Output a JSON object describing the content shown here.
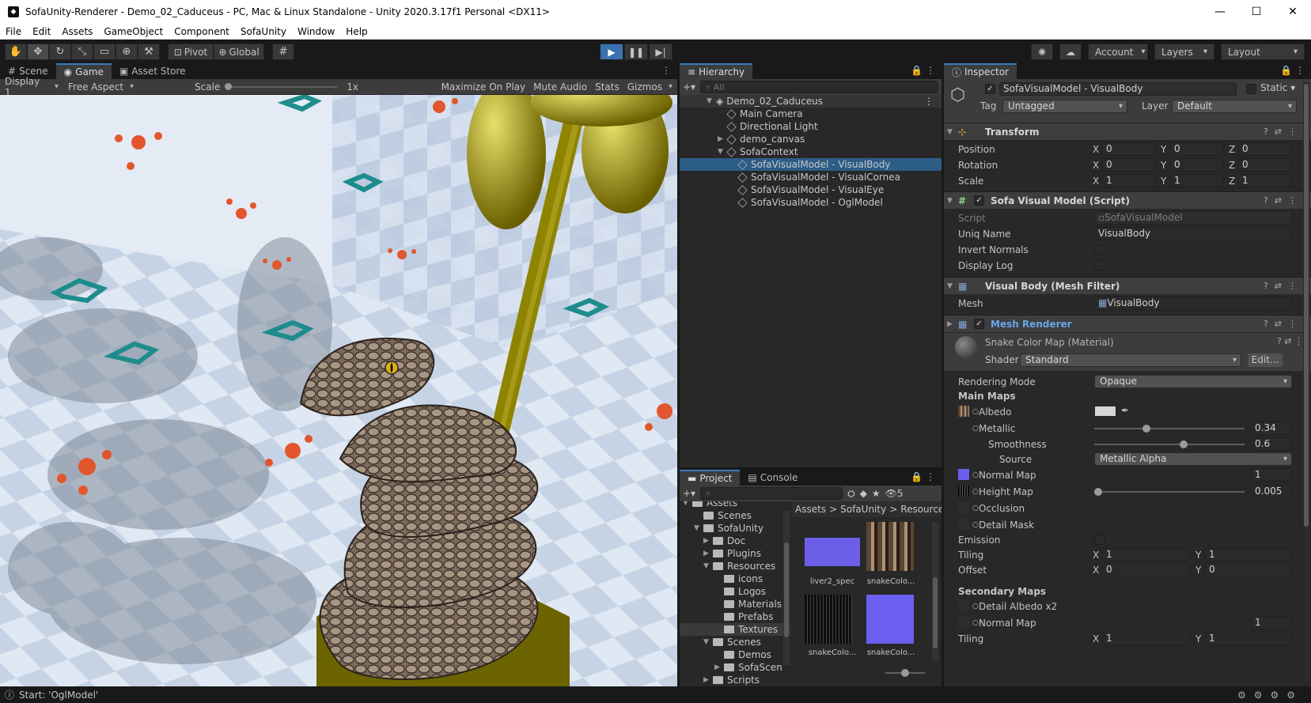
{
  "window": {
    "title": "SofaUnity-Renderer - Demo_02_Caduceus - PC, Mac & Linux Standalone - Unity 2020.3.17f1 Personal <DX11>",
    "minimize": "—",
    "maximize": "☐",
    "close": "✕"
  },
  "menu": [
    "File",
    "Edit",
    "Assets",
    "GameObject",
    "Component",
    "SofaUnity",
    "Window",
    "Help"
  ],
  "toolbar": {
    "pivot": "Pivot",
    "global": "Global",
    "account": "Account",
    "layers": "Layers",
    "layout": "Layout"
  },
  "game_panel": {
    "tabs": [
      "Scene",
      "Game",
      "Asset Store"
    ],
    "display": "Display 1",
    "aspect": "Free Aspect",
    "scale_label": "Scale",
    "scale_value": "1x",
    "maximize": "Maximize On Play",
    "mute": "Mute Audio",
    "stats": "Stats",
    "gizmos": "Gizmos"
  },
  "hierarchy": {
    "tab": "Hierarchy",
    "search_placeholder": "All",
    "scene": "Demo_02_Caduceus",
    "items": [
      {
        "label": "Main Camera"
      },
      {
        "label": "Directional Light"
      },
      {
        "label": "demo_canvas"
      },
      {
        "label": "SofaContext"
      },
      {
        "label": "SofaVisualModel - VisualBody"
      },
      {
        "label": "SofaVisualModel - VisualCornea"
      },
      {
        "label": "SofaVisualModel - VisualEye"
      },
      {
        "label": "SofaVisualModel - OglModel"
      }
    ]
  },
  "project": {
    "tabs": [
      "Project",
      "Console"
    ],
    "hidden_count": "5",
    "tree": [
      {
        "label": "Assets"
      },
      {
        "label": "Scenes"
      },
      {
        "label": "SofaUnity"
      },
      {
        "label": "Doc"
      },
      {
        "label": "Plugins"
      },
      {
        "label": "Resources"
      },
      {
        "label": "icons"
      },
      {
        "label": "Logos"
      },
      {
        "label": "Materials"
      },
      {
        "label": "Prefabs"
      },
      {
        "label": "Textures"
      },
      {
        "label": "Scenes"
      },
      {
        "label": "Demos"
      },
      {
        "label": "SofaScen"
      },
      {
        "label": "Scripts"
      }
    ],
    "breadcrumb": [
      "Assets",
      "SofaUnity",
      "Resources"
    ],
    "assets": [
      {
        "label": "liver2_spec",
        "color": "#6a5fe6"
      },
      {
        "label": "snakeColo...",
        "color": "#4a3a2c"
      },
      {
        "label": "snakeColo...",
        "color": "#141414"
      },
      {
        "label": "snakeColo...",
        "color": "#6b5ff0"
      }
    ]
  },
  "inspector": {
    "tab": "Inspector",
    "object_name": "SofaVisualModel - VisualBody",
    "static": "Static",
    "tag_label": "Tag",
    "tag_value": "Untagged",
    "layer_label": "Layer",
    "layer_value": "Default",
    "transform": {
      "title": "Transform",
      "position": {
        "label": "Position",
        "x": "0",
        "y": "0",
        "z": "0"
      },
      "rotation": {
        "label": "Rotation",
        "x": "0",
        "y": "0",
        "z": "0"
      },
      "scale": {
        "label": "Scale",
        "x": "1",
        "y": "1",
        "z": "1"
      }
    },
    "sofa_script": {
      "title": "Sofa Visual Model (Script)",
      "script_label": "Script",
      "script_value": "SofaVisualModel",
      "uniq_label": "Uniq Name",
      "uniq_value": "VisualBody",
      "invert_label": "Invert Normals",
      "display_label": "Display Log"
    },
    "mesh_filter": {
      "title": "Visual Body (Mesh Filter)",
      "mesh_label": "Mesh",
      "mesh_value": "VisualBody"
    },
    "mesh_renderer": {
      "title": "Mesh Renderer"
    },
    "material": {
      "name": "Snake Color Map (Material)",
      "shader_label": "Shader",
      "shader_value": "Standard",
      "edit": "Edit...",
      "rendering_mode_label": "Rendering Mode",
      "rendering_mode_value": "Opaque",
      "main_maps": "Main Maps",
      "albedo": "Albedo",
      "metallic": "Metallic",
      "metallic_value": "0.34",
      "metallic_fraction": 0.34,
      "smoothness": "Smoothness",
      "smoothness_value": "0.6",
      "smoothness_fraction": 0.6,
      "source_label": "Source",
      "source_value": "Metallic Alpha",
      "normal_map": "Normal Map",
      "normal_value": "1",
      "height_map": "Height Map",
      "height_value": "0.005",
      "height_fraction": 0.0,
      "occlusion": "Occlusion",
      "detail_mask": "Detail Mask",
      "emission": "Emission",
      "tiling_label": "Tiling",
      "tiling_x": "1",
      "tiling_y": "1",
      "offset_label": "Offset",
      "offset_x": "0",
      "offset_y": "0",
      "secondary_maps": "Secondary Maps",
      "detail_albedo": "Detail Albedo x2",
      "sec_normal": "Normal Map",
      "sec_normal_value": "1",
      "sec_tiling_label": "Tiling",
      "sec_tiling_x": "1",
      "sec_tiling_y": "1"
    }
  },
  "status": {
    "message": "Start: 'OglModel'"
  },
  "colors": {
    "accent": "#3a79bb",
    "selection": "#2c5d87",
    "snake_decal": "#e2562d",
    "logo": "#1e8c8c"
  }
}
